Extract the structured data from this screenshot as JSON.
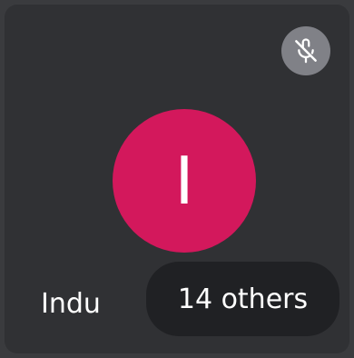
{
  "participant": {
    "initial": "I",
    "name": "Indu",
    "avatar_color": "#d3185c",
    "muted": true,
    "mute_icon": "microphone-off-icon"
  },
  "others": {
    "label": "14 others"
  },
  "colors": {
    "tile_background": "#303134",
    "chip_background": "#202124",
    "mute_badge_background": "#808187"
  }
}
